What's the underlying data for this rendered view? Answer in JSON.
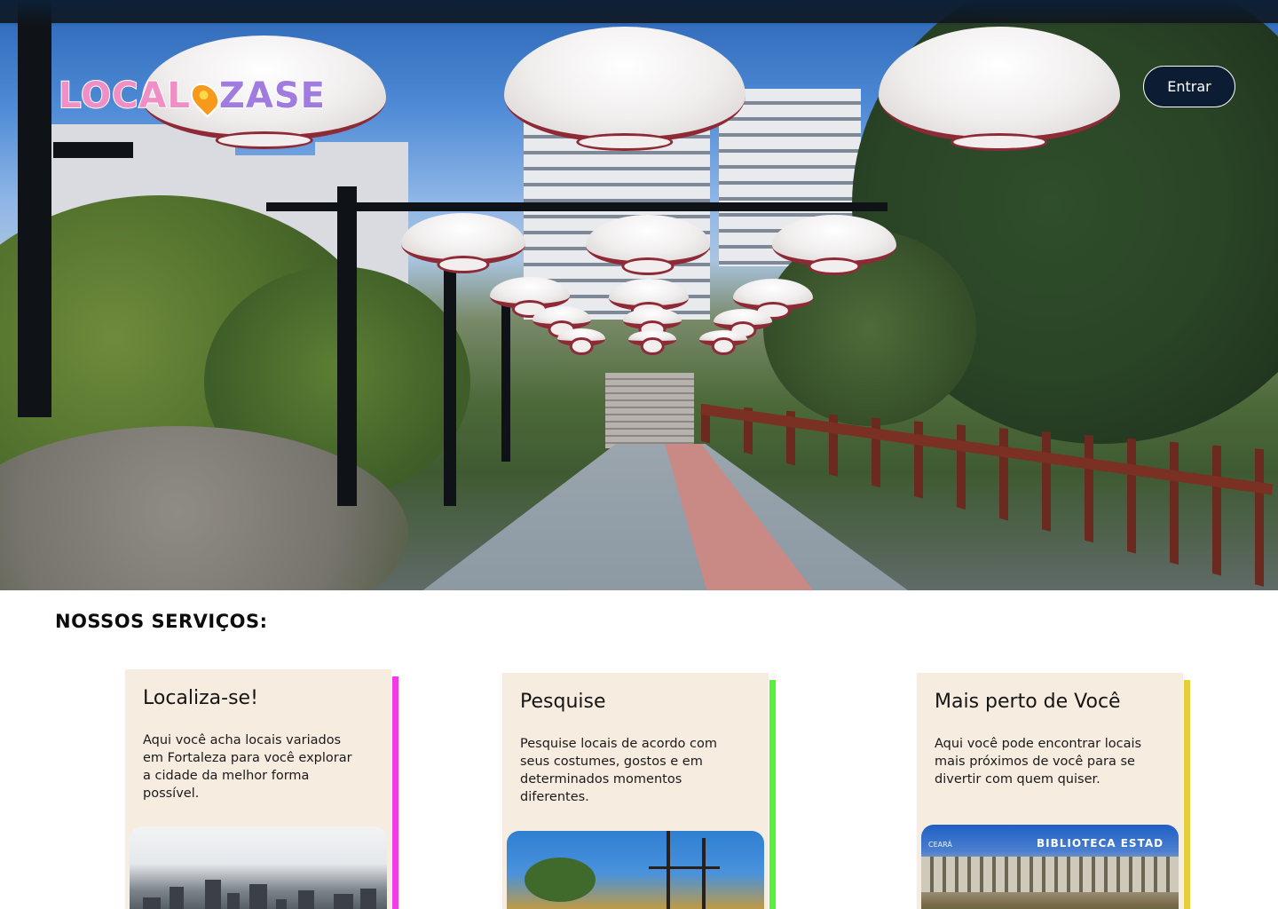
{
  "header": {
    "logo_text": "LOCALIZASE",
    "logo_part1": "LOCAL",
    "logo_part2": "ZASE",
    "login_label": "Entrar"
  },
  "services": {
    "title": "NOSSOS SERVIÇOS:",
    "cards": [
      {
        "title": "Localiza-se!",
        "text": "Aqui você acha locais variados em Fortaleza para você explorar a cidade da melhor forma possível.",
        "accent": "#f23ae6"
      },
      {
        "title": "Pesquise",
        "text": "Pesquise locais de acordo com seus costumes, gostos e em determinados momentos diferentes.",
        "accent": "#55f23a"
      },
      {
        "title": "Mais perto de Você",
        "text": "Aqui você pode encontrar locais mais próximos de você para se divertir com quem quiser.",
        "accent": "#e6cf3a",
        "image_sign": "BIBLIOTECA ESTAD",
        "image_small_sign": "CEARÁ"
      }
    ]
  },
  "colors": {
    "nav_button_bg": "#0c1d33",
    "card_bg": "#f7ece0"
  }
}
